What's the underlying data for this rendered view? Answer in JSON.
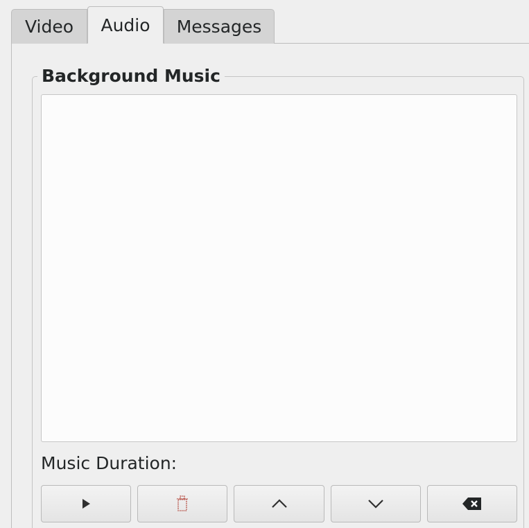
{
  "tabs": [
    {
      "label": "Video",
      "active": false
    },
    {
      "label": "Audio",
      "active": true
    },
    {
      "label": "Messages",
      "active": false
    }
  ],
  "audio": {
    "group_title": "Background Music",
    "music_list_items": [],
    "duration_label": "Music Duration:",
    "buttons": [
      {
        "name": "play",
        "icon": "play-icon"
      },
      {
        "name": "remove",
        "icon": "trash-icon"
      },
      {
        "name": "move-up",
        "icon": "chevron-up-icon"
      },
      {
        "name": "move-down",
        "icon": "chevron-down-icon"
      },
      {
        "name": "clear",
        "icon": "backspace-icon"
      }
    ]
  },
  "colors": {
    "window_bg": "#efefef",
    "list_bg": "#fcfcfc",
    "trash_icon": "#b03a2e",
    "text": "#232627"
  }
}
